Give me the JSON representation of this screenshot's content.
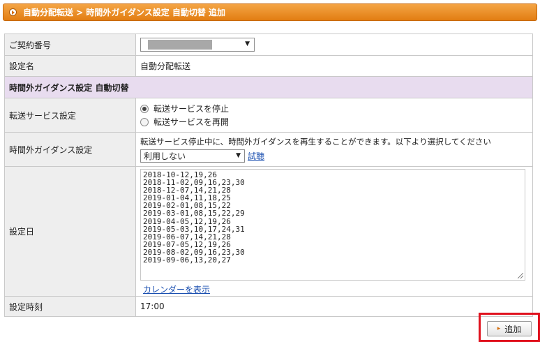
{
  "header": {
    "breadcrumb": "自動分配転送 > 時間外ガイダンス設定  自動切替 追加"
  },
  "form": {
    "contract_number": {
      "label": "ご契約番号",
      "selected": ""
    },
    "setting_name": {
      "label": "設定名",
      "value": "自動分配転送"
    },
    "section_title": "時間外ガイダンス設定  自動切替",
    "transfer_service": {
      "label": "転送サービス設定",
      "options": [
        {
          "label": "転送サービスを停止",
          "checked": true
        },
        {
          "label": "転送サービスを再開",
          "checked": false
        }
      ]
    },
    "guidance": {
      "label": "時間外ガイダンス設定",
      "description": "転送サービス停止中に、時間外ガイダンスを再生することができます。以下より選択してください",
      "selected": "利用しない",
      "trial_link": "試聴"
    },
    "dates": {
      "label": "設定日",
      "lines": [
        "2018-10-12,19,26",
        "2018-11-02,09,16,23,30",
        "2018-12-07,14,21,28",
        "2019-01-04,11,18,25",
        "2019-02-01,08,15,22",
        "2019-03-01,08,15,22,29",
        "2019-04-05,12,19,26",
        "2019-05-03,10,17,24,31",
        "2019-06-07,14,21,28",
        "2019-07-05,12,19,26",
        "2019-08-02,09,16,23,30",
        "2019-09-06,13,20,27"
      ],
      "calendar_link": "カレンダーを表示"
    },
    "time": {
      "label": "設定時刻",
      "value": "17:00"
    }
  },
  "actions": {
    "add_label": "追加"
  },
  "colors": {
    "header": "#e8861a",
    "section": "#e8dcef",
    "highlight": "#e0121e",
    "link": "#1a4fb0"
  }
}
